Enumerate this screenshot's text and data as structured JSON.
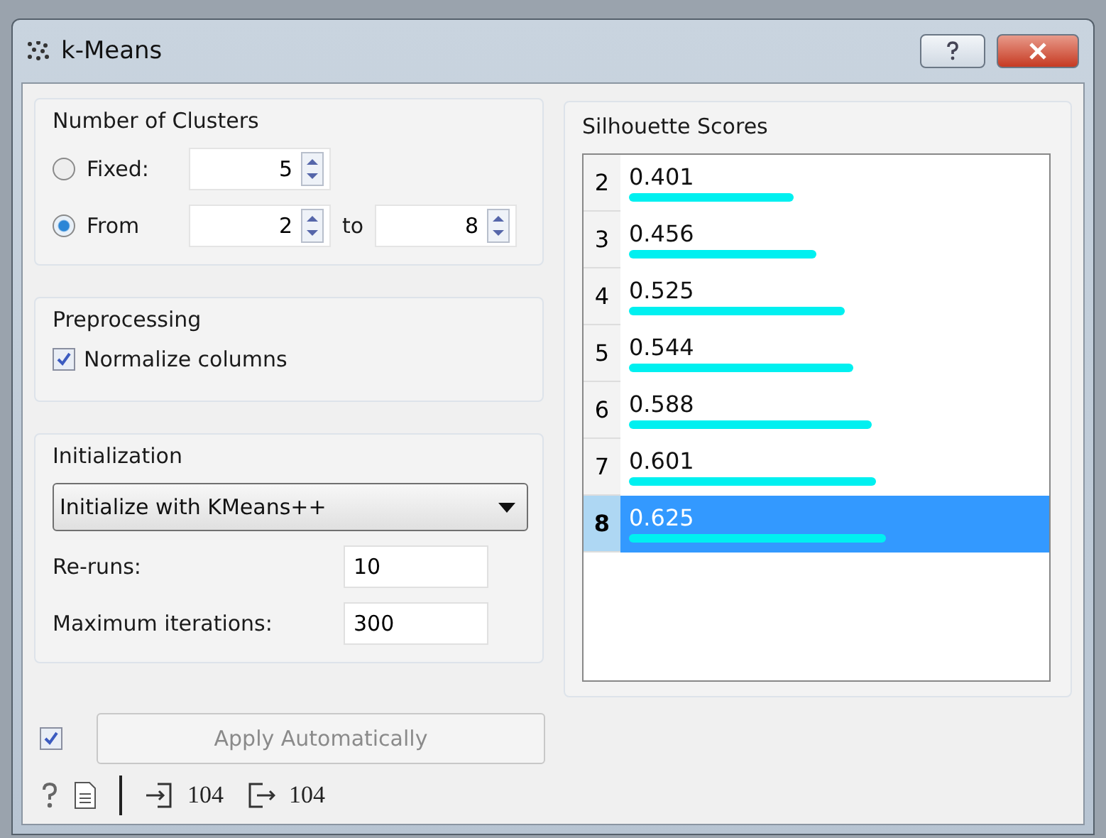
{
  "window": {
    "title": "k-Means"
  },
  "clusters": {
    "title": "Number of Clusters",
    "options": [
      {
        "label": "Fixed:",
        "selected": false,
        "values": [
          "5"
        ]
      },
      {
        "label": "From",
        "selected": true,
        "values": [
          "2",
          "8"
        ],
        "joiner": "to"
      }
    ]
  },
  "preprocessing": {
    "title": "Preprocessing",
    "normalize": {
      "label": "Normalize columns",
      "checked": true
    }
  },
  "initialization": {
    "title": "Initialization",
    "method": "Initialize with KMeans++",
    "fields": [
      {
        "label": "Re-runs:",
        "value": "10"
      },
      {
        "label": "Maximum iterations:",
        "value": "300"
      }
    ]
  },
  "apply": {
    "checked": true,
    "label": "Apply Automatically",
    "disabled": true
  },
  "status": {
    "input_count": "104",
    "output_count": "104"
  },
  "scores": {
    "title": "Silhouette Scores",
    "rows": [
      {
        "k": "2",
        "score": "0.401",
        "selected": false
      },
      {
        "k": "3",
        "score": "0.456",
        "selected": false
      },
      {
        "k": "4",
        "score": "0.525",
        "selected": false
      },
      {
        "k": "5",
        "score": "0.544",
        "selected": false
      },
      {
        "k": "6",
        "score": "0.588",
        "selected": false
      },
      {
        "k": "7",
        "score": "0.601",
        "selected": false
      },
      {
        "k": "8",
        "score": "0.625",
        "selected": true
      }
    ]
  }
}
